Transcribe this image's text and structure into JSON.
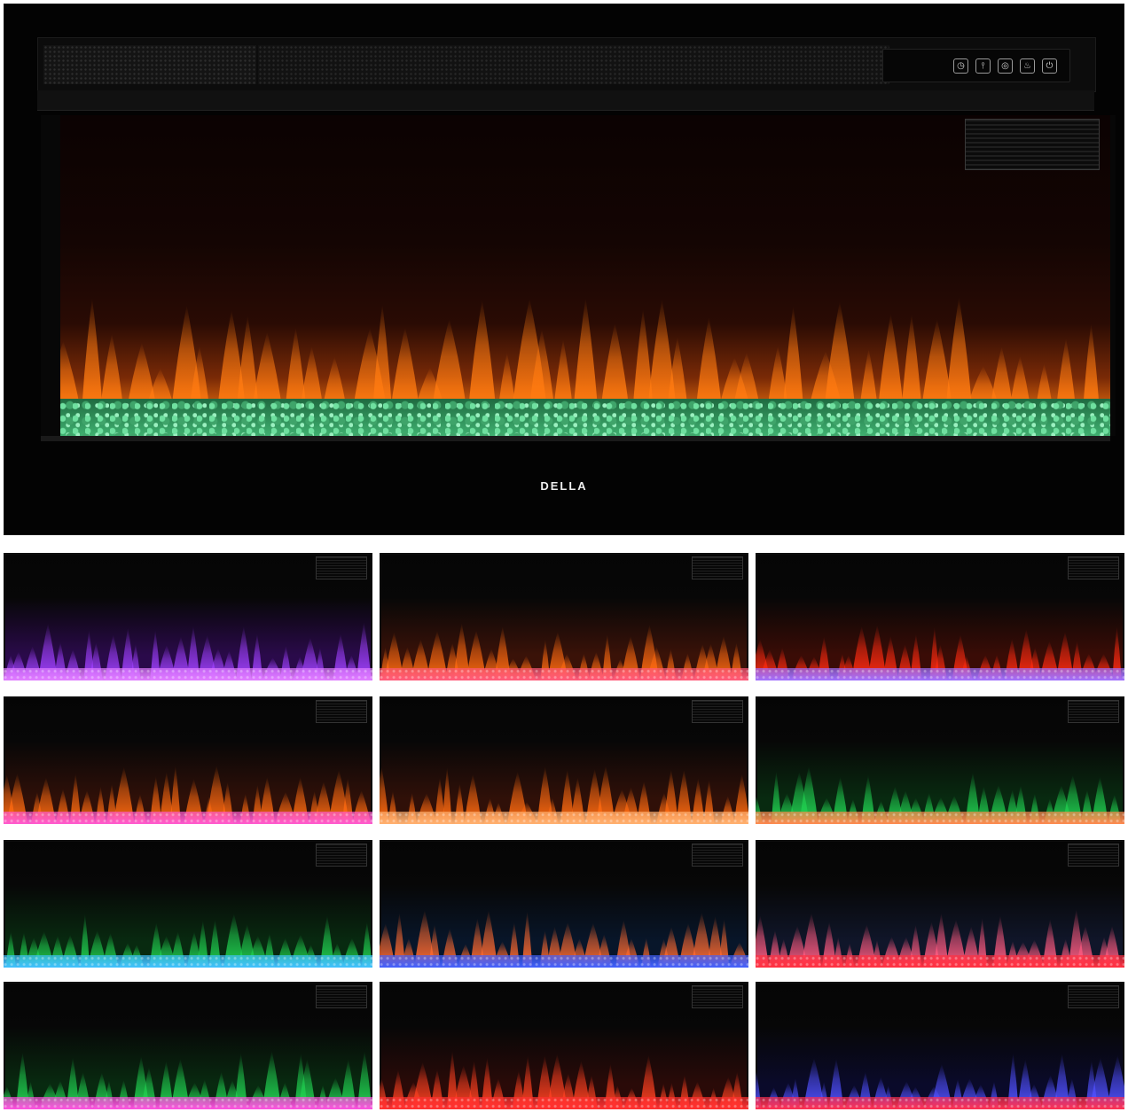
{
  "brand": {
    "logo_text": "DELLA"
  },
  "controls": [
    {
      "name": "timer-icon",
      "glyph": "◷"
    },
    {
      "name": "thermometer-icon",
      "glyph": "⫯"
    },
    {
      "name": "flame-speed-icon",
      "glyph": "◎"
    },
    {
      "name": "flame-icon",
      "glyph": "♨"
    },
    {
      "name": "power-icon",
      "glyph": "⏻"
    }
  ],
  "main_flame": {
    "flame": "#ff7a10",
    "stones": "#3fd27e",
    "glow": "#c85a0c"
  },
  "variants": [
    {
      "flame": "#a040ff",
      "stones": "#e07cff",
      "glow": "#2a0a4a"
    },
    {
      "flame": "#ff6a10",
      "stones": "#ff5a7a",
      "glow": "#3a1208"
    },
    {
      "flame": "#ff2a10",
      "stones": "#a070ff",
      "glow": "#3a0c06"
    },
    {
      "flame": "#ff6a10",
      "stones": "#ff5ad0",
      "glow": "#301008"
    },
    {
      "flame": "#ff6a10",
      "stones": "#ffb070",
      "glow": "#301008"
    },
    {
      "flame": "#20d050",
      "stones": "#ff8a50",
      "glow": "#082a10"
    },
    {
      "flame": "#20d050",
      "stones": "#40c0ff",
      "glow": "#082a10"
    },
    {
      "flame": "#ff6a30",
      "stones": "#4060ff",
      "glow": "#08162a"
    },
    {
      "flame": "#ff5a80",
      "stones": "#ff3040",
      "glow": "#10162a"
    },
    {
      "flame": "#20d050",
      "stones": "#ff50e0",
      "glow": "#082a10"
    },
    {
      "flame": "#ff4020",
      "stones": "#ff3030",
      "glow": "#2a0a08"
    },
    {
      "flame": "#5050ff",
      "stones": "#ff3050",
      "glow": "#0a0a2a"
    }
  ]
}
